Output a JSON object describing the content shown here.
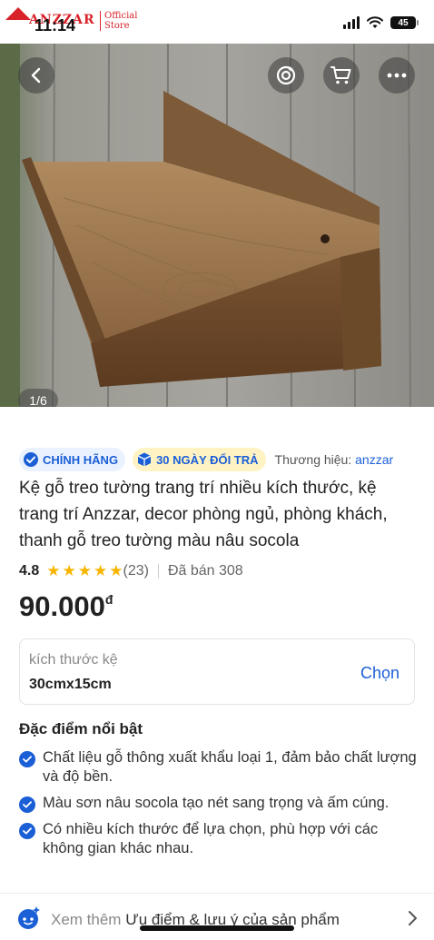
{
  "status_bar": {
    "time": "11:14",
    "battery": "45",
    "brand_logo_text": "ANZZAR",
    "brand_logo_sub_1": "Official",
    "brand_logo_sub_2": "Store"
  },
  "gallery": {
    "counter": "1/6",
    "current_index": 1,
    "total": 6,
    "icons": [
      "back-icon",
      "ai-lens-icon",
      "cart-icon",
      "more-icon"
    ]
  },
  "badges": {
    "authentic_label": "CHÍNH HÃNG",
    "return_label": "30 NGÀY ĐỔI TRẢ",
    "brand_prefix": "Thương hiệu:",
    "brand_name": "anzzar"
  },
  "product": {
    "title": "Kệ gỗ treo tường trang trí nhiều kích thước, kệ trang trí Anzzar, decor phòng ngủ, phòng khách, thanh gỗ treo tường màu nâu socola",
    "rating": "4.8",
    "stars": 5,
    "review_count": "(23)",
    "sold": "Đã bán 308",
    "price": "90.000",
    "currency": "đ"
  },
  "variant": {
    "label": "kích thước kệ",
    "value": "30cmx15cm",
    "choose_label": "Chọn"
  },
  "highlights": {
    "title": "Đặc điểm nổi bật",
    "items": [
      "Chất liệu gỗ thông xuất khẩu loại 1, đảm bảo chất lượng và độ bền.",
      "Màu sơn nâu socola tạo nét sang trọng và ấm cúng.",
      "Có nhiều kích thước để lựa chọn, phù hợp với các không gian khác nhau."
    ]
  },
  "bottom": {
    "prefix": "Xem thêm",
    "strong": "Ưu điểm & lưu ý của sản phẩm"
  },
  "colors": {
    "accent_blue": "#1a5fd6",
    "star_yellow": "#f7b500",
    "brand_red": "#d8232a",
    "return_badge_bg": "#fff3c4",
    "authentic_badge_bg": "#eaf1ff"
  }
}
